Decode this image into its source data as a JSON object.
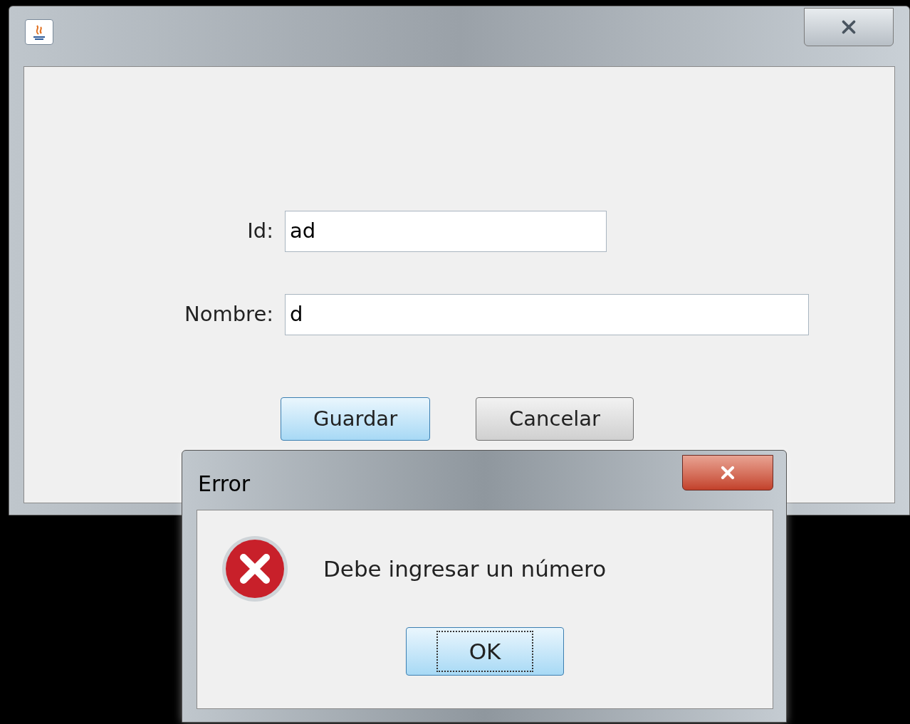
{
  "main_window": {
    "fields": [
      {
        "label": "Id:",
        "value": "ad"
      },
      {
        "label": "Nombre:",
        "value": "d"
      }
    ],
    "buttons": [
      {
        "label": "Guardar",
        "default": true
      },
      {
        "label": "Cancelar",
        "default": false
      }
    ]
  },
  "error_dialog": {
    "title": "Error",
    "message": "Debe ingresar un número",
    "button": {
      "label": "OK",
      "focused": true
    }
  }
}
